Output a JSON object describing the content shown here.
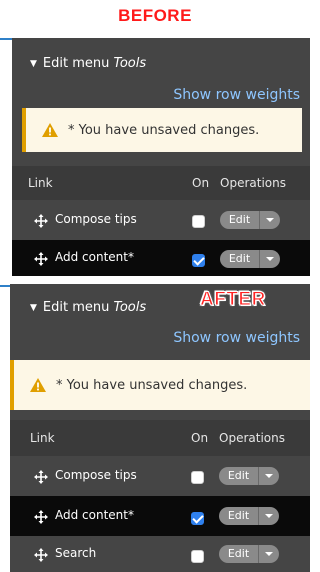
{
  "labels": {
    "before": "BEFORE",
    "after": "AFTER"
  },
  "menu": {
    "title_prefix": "Edit menu",
    "title_name": "Tools",
    "show_row_weights": "Show row weights",
    "warning": "* You have unsaved changes."
  },
  "table": {
    "headers": {
      "link": "Link",
      "on": "On",
      "operations": "Operations"
    },
    "edit_label": "Edit"
  },
  "before_rows": [
    {
      "label": "Compose tips",
      "checked": false
    },
    {
      "label": "Add content*",
      "checked": true
    }
  ],
  "after_rows": [
    {
      "label": "Compose tips",
      "checked": false
    },
    {
      "label": "Add content*",
      "checked": true
    },
    {
      "label": "Search",
      "checked": false
    }
  ],
  "colors": {
    "panel_bg": "#454545",
    "link_blue": "#8ec6ff",
    "warning_bg": "#fdf7e6",
    "warning_accent": "#e09f00",
    "checkbox_checked": "#2f80ed",
    "label_red": "#ff1a1a"
  },
  "icons": [
    "expand-triangle-icon",
    "warning-icon",
    "move-handle-icon",
    "dropdown-caret-icon"
  ]
}
